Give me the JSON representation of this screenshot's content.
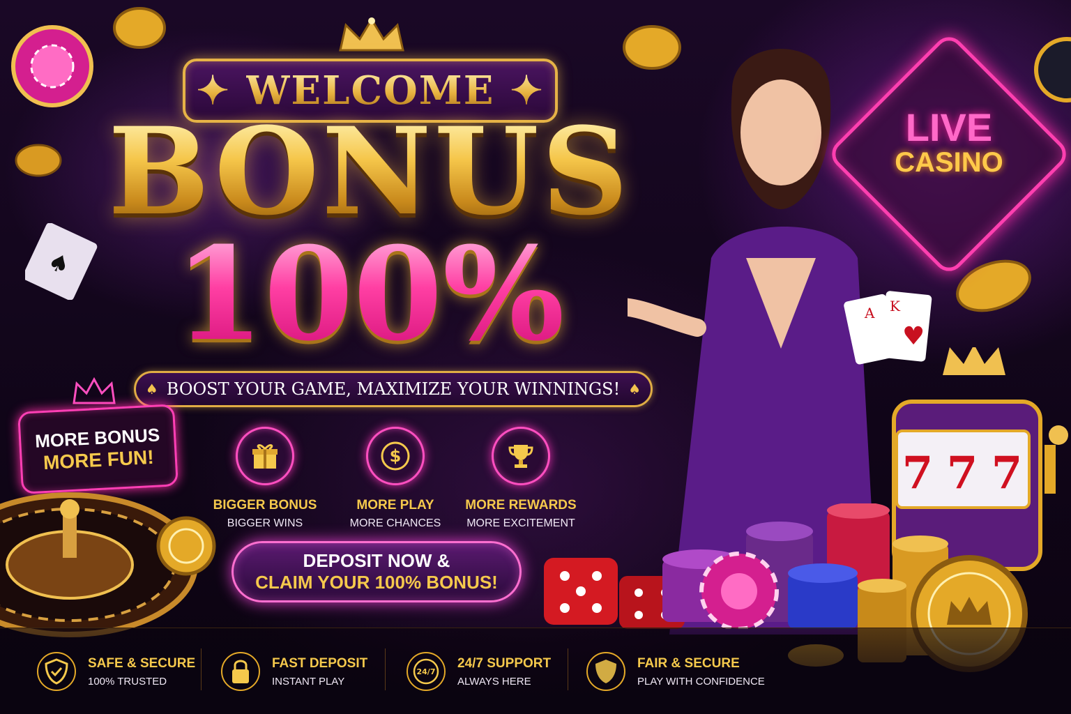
{
  "banner": {
    "welcome": "WELCOME",
    "bonus": "BONUS",
    "percent": "100%",
    "tagline": "BOOST YOUR GAME, MAXIMIZE YOUR WINNINGS!"
  },
  "badge": {
    "line1": "MORE BONUS",
    "line2": "MORE FUN!"
  },
  "features": [
    {
      "icon": "gift-icon",
      "title": "BIGGER BONUS",
      "subtitle": "BIGGER WINS"
    },
    {
      "icon": "dollar-coin-icon",
      "title": "MORE PLAY",
      "subtitle": "MORE CHANCES"
    },
    {
      "icon": "trophy-icon",
      "title": "MORE REWARDS",
      "subtitle": "MORE EXCITEMENT"
    }
  ],
  "cta": {
    "line1": "DEPOSIT NOW &",
    "line2": "CLAIM YOUR 100% BONUS!"
  },
  "trust": [
    {
      "icon": "shield-check-icon",
      "title": "SAFE & SECURE",
      "subtitle": "100% TRUSTED"
    },
    {
      "icon": "padlock-icon",
      "title": "FAST DEPOSIT",
      "subtitle": "INSTANT PLAY"
    },
    {
      "icon": "support-24-7-icon",
      "title": "24/7 SUPPORT",
      "subtitle": "ALWAYS HERE",
      "icon_text": "24/7"
    },
    {
      "icon": "shield-icon",
      "title": "FAIR & SECURE",
      "subtitle": "PLAY WITH CONFIDENCE"
    }
  ],
  "sign": {
    "line1": "LIVE",
    "line2": "CASINO"
  },
  "cards": {
    "card1": "A",
    "card2": "K"
  },
  "slot_reels": [
    "7",
    "7",
    "7"
  ],
  "colors": {
    "gold": "#f5c94c",
    "pink": "#ff3fa3",
    "purple": "#4a1460",
    "neon": "#ff3fb5"
  }
}
